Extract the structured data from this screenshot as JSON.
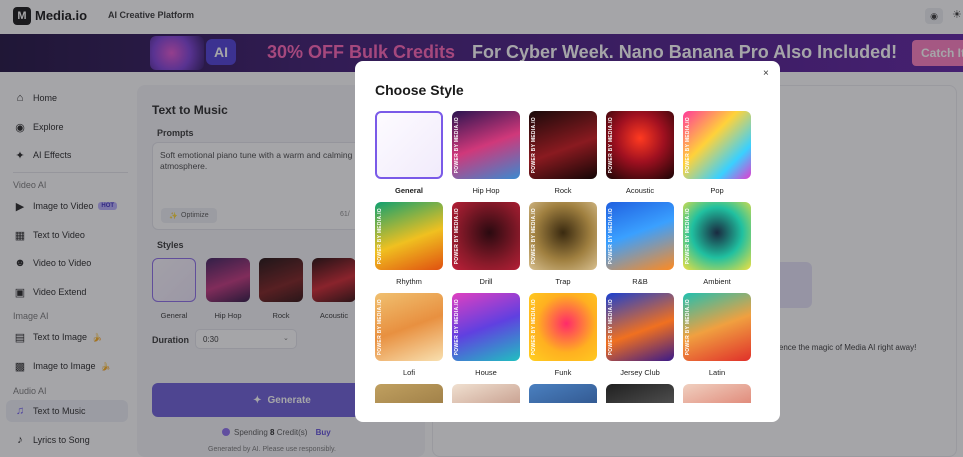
{
  "app": {
    "logo_mark": "M",
    "logo_text": "Media.io",
    "platform": "AI Creative Platform"
  },
  "banner": {
    "ai_badge": "AI",
    "headline": "30% OFF Bulk Credits",
    "subline": "For Cyber Week. Nano Banana Pro Also Included!",
    "cta": "Catch It"
  },
  "sidebar": {
    "items_top": [
      {
        "label": "Home",
        "icon": "home-icon"
      },
      {
        "label": "Explore",
        "icon": "compass-icon"
      },
      {
        "label": "AI Effects",
        "icon": "sparkle-icon"
      }
    ],
    "video_head": "Video AI",
    "video_items": [
      {
        "label": "Image to Video",
        "badge": "HOT"
      },
      {
        "label": "Text to Video"
      },
      {
        "label": "Video to Video"
      },
      {
        "label": "Video Extend"
      }
    ],
    "image_head": "Image AI",
    "image_items": [
      {
        "label": "Text to Image"
      },
      {
        "label": "Image to Image"
      }
    ],
    "audio_head": "Audio AI",
    "audio_items": [
      {
        "label": "Text to Music"
      },
      {
        "label": "Lyrics to Song"
      }
    ]
  },
  "panel": {
    "title": "Text to Music",
    "prompts_label": "Prompts",
    "prompt_text": "Soft emotional piano tune with a warm and calming atmosphere.",
    "optimize_label": "Optimize",
    "char_count": "61/",
    "styles_label": "Styles",
    "styles": [
      {
        "label": "General"
      },
      {
        "label": "Hip Hop"
      },
      {
        "label": "Rock"
      },
      {
        "label": "Acoustic"
      }
    ],
    "duration_label": "Duration",
    "duration_value": "0:30",
    "generate_label": "Generate",
    "spending_prefix": "Spending",
    "spending_amount": "8",
    "spending_suffix": "Credit(s)",
    "buy_label": "Buy",
    "note": "Generated by AI. Please use responsibly."
  },
  "right": {
    "tagline": "erience the magic of Media AI right away!"
  },
  "modal": {
    "title": "Choose Style",
    "close": "×",
    "side_text": "POWER BY MEDIA.IO",
    "styles": [
      {
        "label": "General",
        "selected": true
      },
      {
        "label": "Hip Hop"
      },
      {
        "label": "Rock"
      },
      {
        "label": "Acoustic"
      },
      {
        "label": "Pop"
      },
      {
        "label": "Rhythm"
      },
      {
        "label": "Drill"
      },
      {
        "label": "Trap"
      },
      {
        "label": "R&B"
      },
      {
        "label": "Ambient"
      },
      {
        "label": "Lofi"
      },
      {
        "label": "House"
      },
      {
        "label": "Funk"
      },
      {
        "label": "Jersey Club"
      },
      {
        "label": "Latin"
      }
    ]
  },
  "colors": {
    "accent": "#6a5bd8",
    "banner_pink": "#ff5fb6",
    "selected_border": "#7a5ae8"
  }
}
